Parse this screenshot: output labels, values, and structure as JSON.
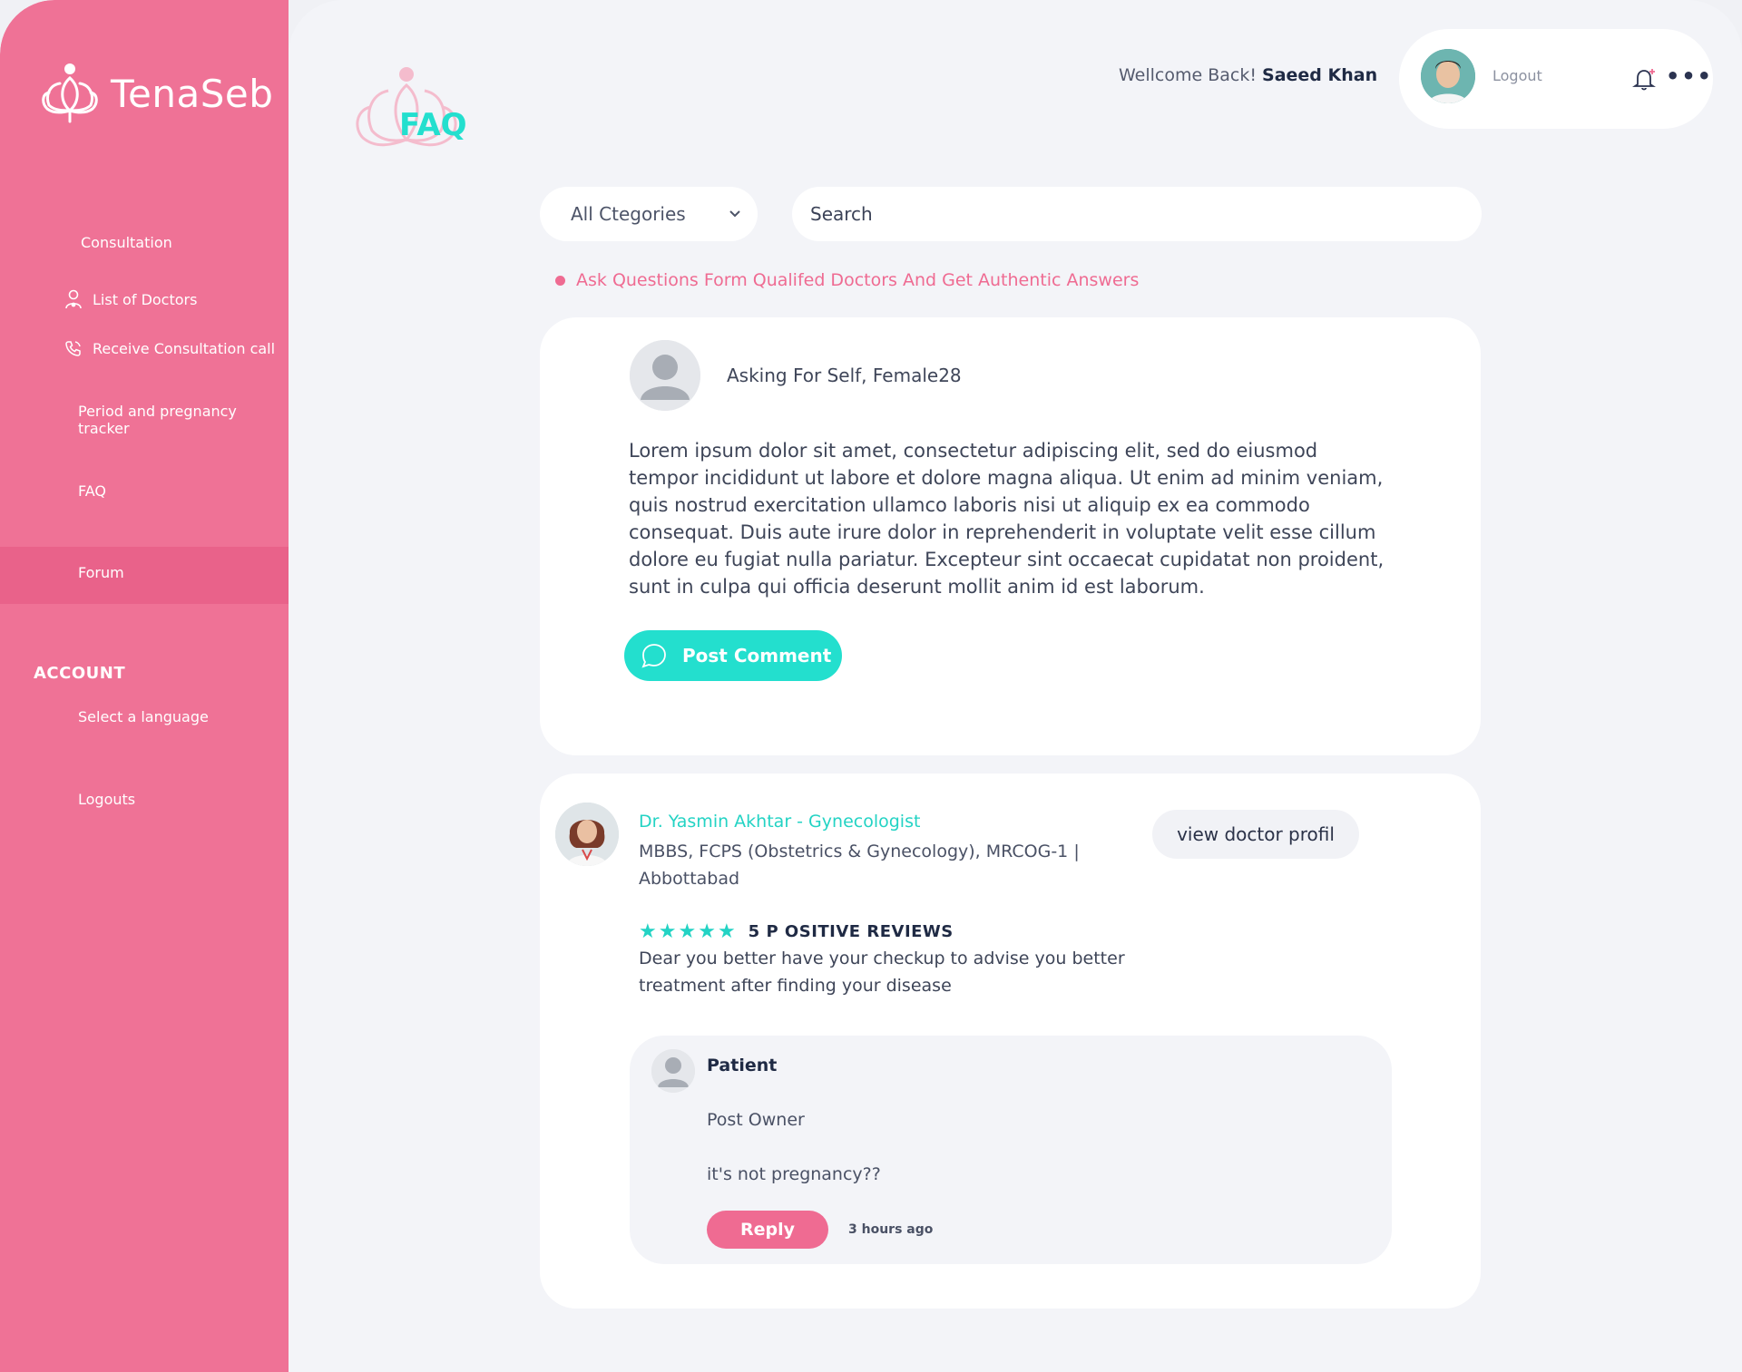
{
  "colors": {
    "sidebar": "#ef7296",
    "accent_teal": "#23dfce",
    "accent_pink": "#ef6b92",
    "text_dark": "#1f2a44"
  },
  "brand": {
    "name": "TenaSeb",
    "logo_icon": "lotus-logo-icon"
  },
  "sidebar": {
    "items": [
      {
        "label": "Consultation"
      },
      {
        "label": "List of Doctors",
        "icon": "doctor-user-icon"
      },
      {
        "label": "Receive Consultation call",
        "icon": "phone-icon"
      },
      {
        "label": "Period and pregnancy tracker"
      },
      {
        "label": "FAQ"
      },
      {
        "label": "Forum",
        "active": true
      }
    ],
    "account_heading": "ACCOUNT",
    "account_items": [
      {
        "label": "Select a language"
      },
      {
        "label": "Logouts"
      }
    ]
  },
  "page": {
    "title": "FAQ"
  },
  "header": {
    "welcome": "Wellcome Back!",
    "user_name": "Saeed Khan",
    "logout": "Logout",
    "bell_icon": "notification-bell-icon",
    "more_icon": "more-dots-icon"
  },
  "filters": {
    "category_selected": "All Ctegories",
    "search_placeholder": "Search"
  },
  "tagline": "Ask Questions Form Qualifed Doctors And Get Authentic Answers",
  "question_card": {
    "asker": "Asking For Self, Female28",
    "body": "Lorem ipsum dolor sit amet, consectetur adipiscing elit, sed do eiusmod tempor incididunt ut labore et dolore magna aliqua. Ut enim ad minim veniam, quis nostrud exercitation ullamco laboris nisi ut aliquip ex ea commodo consequat. Duis aute irure dolor in reprehenderit in voluptate velit esse cillum dolore eu fugiat nulla pariatur. Excepteur sint occaecat cupidatat non proident, sunt in culpa qui officia deserunt mollit anim id est laborum.",
    "post_comment": "Post Comment"
  },
  "answer_card": {
    "doctor_name": "Dr. Yasmin Akhtar - Gynecologist",
    "doctor_quals": "MBBS, FCPS (Obstetrics & Gynecology), MRCOG-1 | Abbottabad",
    "view_profile": "view doctor profil",
    "rating": 5,
    "reviews_label": "5 P OSITIVE REVIEWS",
    "advice": "Dear you better have your checkup to advise you better treatment after finding your disease",
    "reply": {
      "author": "Patient",
      "role": "Post Owner",
      "text": "it's not pregnancy??",
      "reply_button": "Reply",
      "time": "3 hours ago"
    }
  }
}
